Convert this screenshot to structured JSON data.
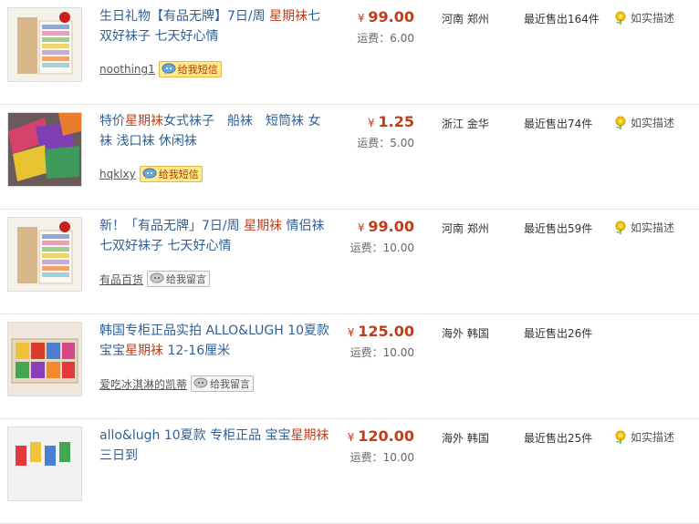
{
  "listings": [
    {
      "title_prefix": "生日礼物【有品无牌】7日/周 ",
      "title_highlight": "星期袜",
      "title_suffix": "七双好袜子 七天好心情",
      "price_symbol": "¥",
      "price": "99.00",
      "shipping": "运费：6.00",
      "location": "河南 郑州",
      "sold": "最近售出164件",
      "desc_label": "如实描述",
      "seller": "noothing1",
      "message_label": "给我短信",
      "message_type": "sms"
    },
    {
      "title_prefix": "特价",
      "title_highlight": "星期袜",
      "title_suffix": "女式袜子　船袜　短筒袜 女袜 浅口袜 休闲袜",
      "price_symbol": "¥",
      "price": "1.25",
      "shipping": "运费：5.00",
      "location": "浙江 金华",
      "sold": "最近售出74件",
      "desc_label": "如实描述",
      "seller": "hqklxy",
      "message_label": "给我短信",
      "message_type": "sms"
    },
    {
      "title_prefix": "新！「有品无牌」7日/周 ",
      "title_highlight": "星期袜",
      "title_suffix": " 情侣袜 七双好袜子 七天好心情",
      "price_symbol": "¥",
      "price": "99.00",
      "shipping": "运费：10.00",
      "location": "河南 郑州",
      "sold": "最近售出59件",
      "desc_label": "如实描述",
      "seller": "有品百货",
      "message_label": "给我留言",
      "message_type": "leave"
    },
    {
      "title_prefix": "韩国专柜正品实拍 ALLO&LUGH 10夏款 宝宝",
      "title_highlight": "星期袜",
      "title_suffix": " 12-16厘米",
      "price_symbol": "¥",
      "price": "125.00",
      "shipping": "运费：10.00",
      "location": "海外 韩国",
      "sold": "最近售出26件",
      "desc_label": "",
      "seller": "爱吃冰淇淋的凯蒂",
      "message_label": "给我留言",
      "message_type": "leave"
    },
    {
      "title_prefix": "allo&lugh 10夏款 专柜正品 宝宝",
      "title_highlight": "星期袜",
      "title_suffix": " 三日到",
      "price_symbol": "¥",
      "price": "120.00",
      "shipping": "运费：10.00",
      "location": "海外 韩国",
      "sold": "最近售出25件",
      "desc_label": "如实描述",
      "seller": "",
      "message_label": "",
      "message_type": "leave"
    }
  ],
  "colors": {
    "title_link": "#2f5f96",
    "highlight": "#c13d1a",
    "price": "#c13d1a"
  },
  "icons": {
    "desc_badge": "yellow-flower-icon",
    "sms": "speech-bubble-icon",
    "leave_message": "message-bubble-icon"
  }
}
